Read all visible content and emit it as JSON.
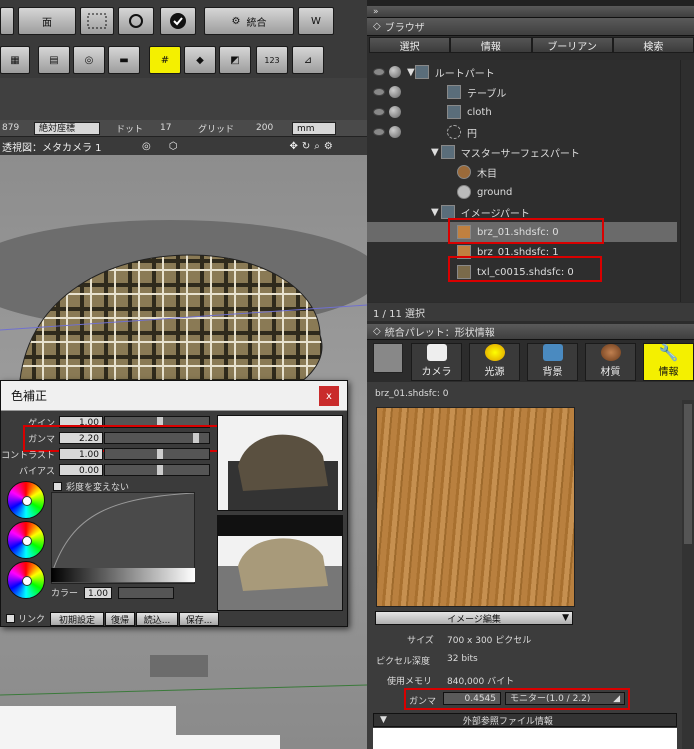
{
  "left_toolbar": {
    "row1": [
      "",
      "面",
      "統合",
      ""
    ],
    "vp_bar": {
      "coord_value": "879",
      "coord_mode": "絶対座標",
      "dot_label": "ドット",
      "dot_value": "17",
      "grid_label": "グリッド",
      "grid_value": "200",
      "unit": "mm"
    },
    "view_title": "透視図：メタカメラ 1"
  },
  "color_dialog": {
    "title": "色補正",
    "close": "x",
    "rows": [
      {
        "label": "ゲイン",
        "value": "1.00",
        "fill": 0.5
      },
      {
        "label": "ガンマ",
        "value": "2.20",
        "fill": 0.85
      },
      {
        "label": "コントラスト",
        "value": "1.00",
        "fill": 0.5
      },
      {
        "label": "バイアス",
        "value": "0.00",
        "fill": 0.5
      }
    ],
    "keep_saturation": "彩度を変えない",
    "color_label": "カラー",
    "color_value": "1.00",
    "link_label": "リンク",
    "buttons": [
      "初期設定",
      "復帰",
      "読込...",
      "保存..."
    ]
  },
  "browser": {
    "title": "ブラウザ",
    "tabs": [
      "選択",
      "情報",
      "ブーリアン",
      "検索"
    ],
    "tree": [
      {
        "label": "ルートパート",
        "indent": 0
      },
      {
        "label": "テーブル",
        "indent": 1
      },
      {
        "label": "cloth",
        "indent": 1
      },
      {
        "label": "円",
        "indent": 1
      },
      {
        "label": "マスターサーフェスパート",
        "indent": 1
      },
      {
        "label": "木目",
        "indent": 2
      },
      {
        "label": "ground",
        "indent": 2
      },
      {
        "label": "イメージパート",
        "indent": 1
      },
      {
        "label": "brz_01.shdsfc: 0",
        "indent": 2
      },
      {
        "label": "brz_01.shdsfc: 1",
        "indent": 2
      },
      {
        "label": "txl_c0015.shdsfc: 0",
        "indent": 2
      }
    ],
    "status": "1 / 11 選択"
  },
  "palette": {
    "title": "統合パレット：形状情報",
    "tabs": [
      "カメラ",
      "光源",
      "背景",
      "材質",
      "情報"
    ],
    "image_name": "brz_01.shdsfc: 0",
    "edit_button": "イメージ編集",
    "size_label": "サイズ",
    "size_value": "700 x 300 ピクセル",
    "depth_label": "ピクセル深度",
    "depth_value": "32 bits",
    "memory_label": "使用メモリ",
    "memory_value": "840,000 バイト",
    "gamma_label": "ガンマ",
    "gamma_value": "0.4545",
    "gamma_mode": "モニター(1.0 / 2.2)",
    "external_label": "外部参照ファイル情報"
  },
  "colors": {
    "highlight": "#d90000",
    "accent": "#f4f000",
    "wood": "#b9803f"
  }
}
